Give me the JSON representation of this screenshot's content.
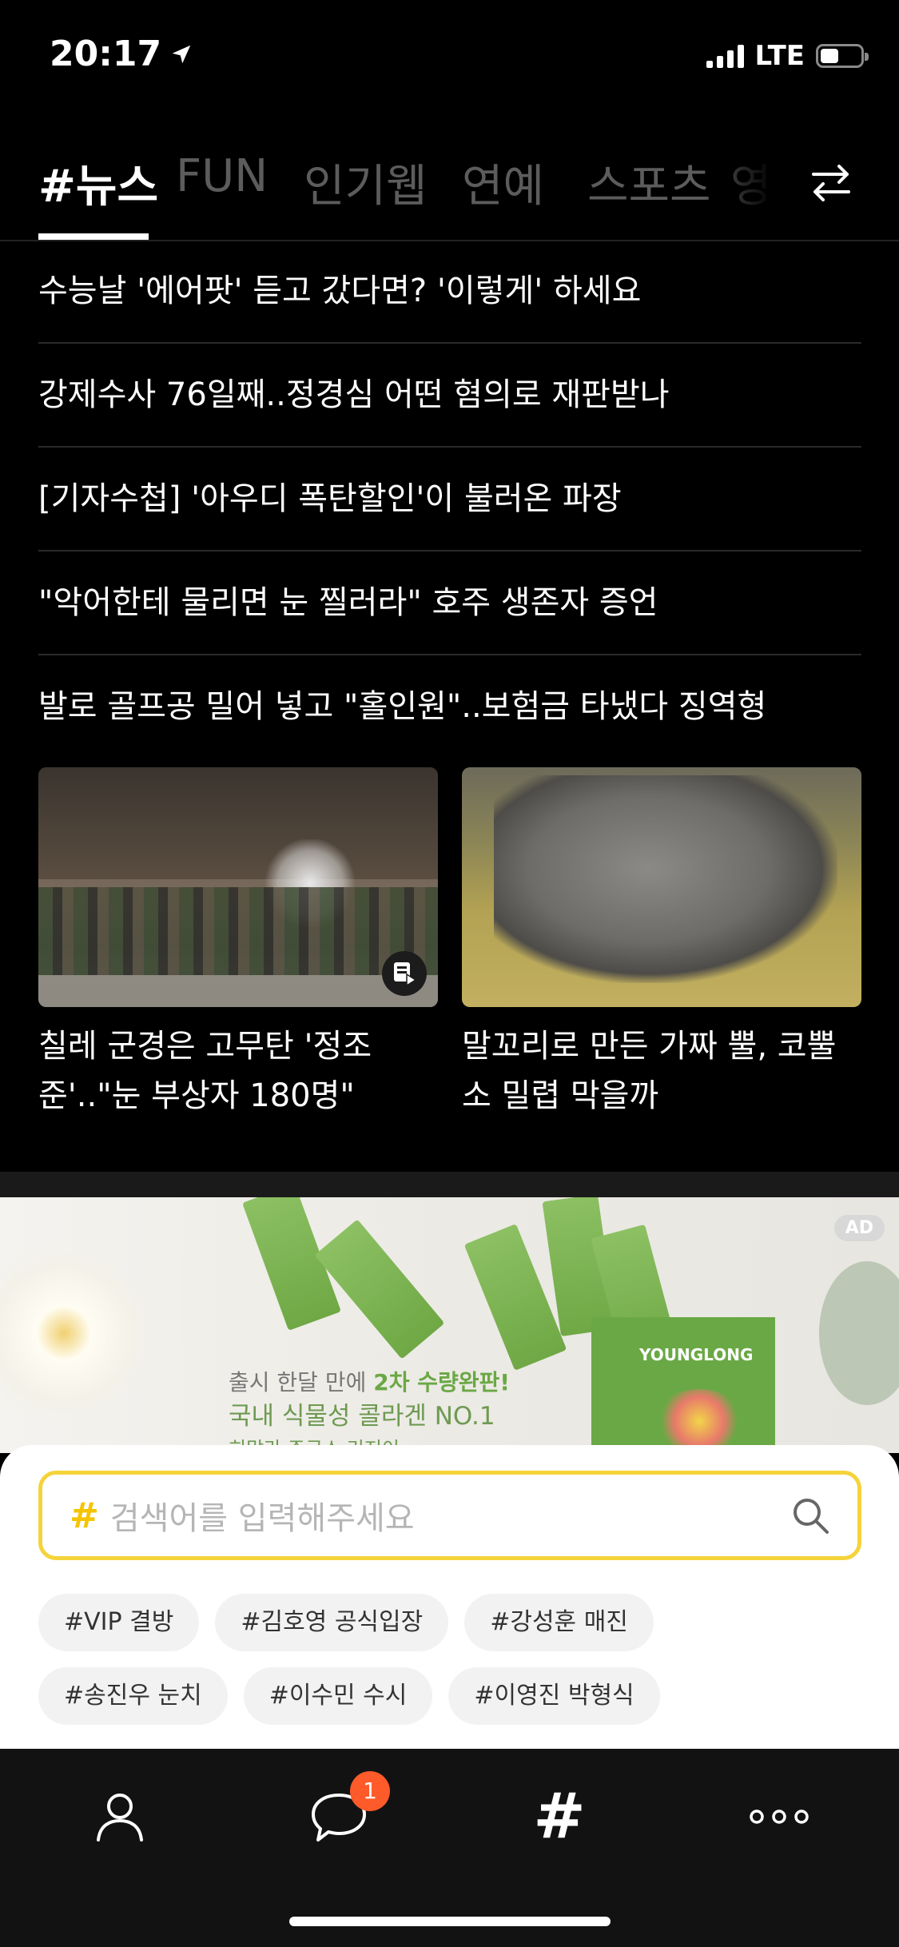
{
  "status_bar": {
    "time": "20:17",
    "network": "LTE"
  },
  "tabs": [
    {
      "label": "#뉴스",
      "active": true
    },
    {
      "label": "FUN",
      "active": false
    },
    {
      "label": "인기웹",
      "active": false
    },
    {
      "label": "연예",
      "active": false
    },
    {
      "label": "스포츠",
      "active": false
    },
    {
      "label": "영",
      "active": false
    }
  ],
  "headlines": [
    "수능날 '에어팟' 듣고 갔다면? '이렇게' 하세요",
    "강제수사 76일째..정경심 어떤 혐의로 재판받나",
    "[기자수첩] '아우디 폭탄할인'이 불러온 파장",
    "\"악어한테 물리면 눈 찔러라\" 호주 생존자 증언",
    "발로 골프공 밀어 넣고 \"홀인원\"..보험금 타냈다 징역형"
  ],
  "cards": [
    {
      "title": "칠레 군경은 고무탄 '정조준'..\"눈 부상자 180명\"",
      "video": true
    },
    {
      "title": "말꼬리로 만든 가짜 뿔, 코뿔소 밀렵 막을까",
      "video": false
    }
  ],
  "ad": {
    "badge": "AD",
    "line1_pre": "출시 한달 만에 ",
    "line1_highlight": "2차 수량완판!",
    "line2": "국내 식물성 콜라겐 NO.1",
    "line3": "히말라 주근스 리저이",
    "brand": "YOUNGLONG"
  },
  "search": {
    "hash": "#",
    "placeholder": "검색어를 입력해주세요"
  },
  "chips": [
    [
      "#VIP 결방",
      "#김호영 공식입장",
      "#강성훈 매진"
    ],
    [
      "#송진우 눈치",
      "#이수민 수시",
      "#이영진 박형식"
    ]
  ],
  "bottom_nav": {
    "chat_badge": "1",
    "hash_label": "#"
  },
  "colors": {
    "accent_yellow": "#f5d33a",
    "badge_orange": "#ff5a2a",
    "background": "#000000"
  }
}
